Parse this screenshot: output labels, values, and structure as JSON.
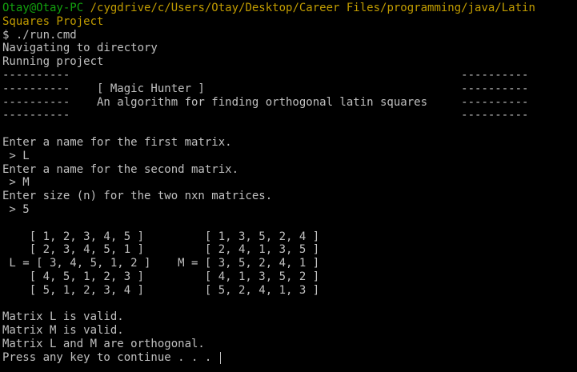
{
  "colors": {
    "background": "#000000",
    "text": "#c0c0c0",
    "user_host": "#13a10e",
    "path": "#c19c00"
  },
  "prompt": {
    "user_host": "Otay@Otay-PC",
    "path_line1": " /cygdrive/c/Users/Otay/Desktop/Career Files/programming/java/Latin",
    "path_line2": "Squares Project"
  },
  "lines": [
    "$ ./run.cmd",
    "Navigating to directory",
    "Running project",
    "----------                                                          ----------",
    "----------    [ Magic Hunter ]                                      ----------",
    "----------    An algorithm for finding orthogonal latin squares     ----------",
    "----------                                                          ----------",
    "",
    "Enter a name for the first matrix.",
    " > L",
    "Enter a name for the second matrix.",
    " > M",
    "Enter size (n) for the two nxn matrices.",
    " > 5",
    "",
    "    [ 1, 2, 3, 4, 5 ]         [ 1, 3, 5, 2, 4 ]",
    "    [ 2, 3, 4, 5, 1 ]         [ 2, 4, 1, 3, 5 ]",
    " L = [ 3, 4, 5, 1, 2 ]    M = [ 3, 5, 2, 4, 1 ]",
    "    [ 4, 5, 1, 2, 3 ]         [ 4, 1, 3, 5, 2 ]",
    "    [ 5, 1, 2, 3, 4 ]         [ 5, 2, 4, 1, 3 ]",
    "",
    "Matrix L is valid.",
    "Matrix M is valid.",
    "Matrix L and M are orthogonal."
  ],
  "final_line": "Press any key to continue . . . "
}
